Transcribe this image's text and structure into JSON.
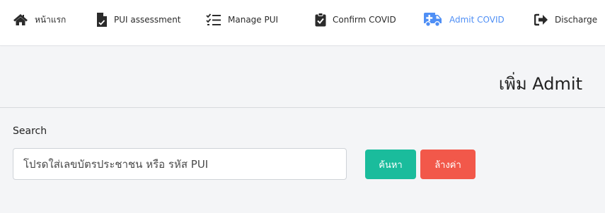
{
  "nav": {
    "items": [
      {
        "label": "หน้าแรก",
        "icon": "home-icon"
      },
      {
        "label": "PUI assessment",
        "icon": "file-medical-icon"
      },
      {
        "label": "Manage PUI",
        "icon": "task-list-icon"
      },
      {
        "label": "Confirm COVID",
        "icon": "clipboard-check-icon"
      },
      {
        "label": "Admit COVID",
        "icon": "ambulance-icon",
        "active": true
      },
      {
        "label": "Discharge",
        "icon": "sign-out-icon"
      }
    ],
    "active_color": "#4f8ff5"
  },
  "page": {
    "title": "เพิ่ม Admit"
  },
  "search": {
    "label": "Search",
    "placeholder": "โปรดใส่เลขบัตรประชาชน หรือ รหัส PUI",
    "value": "",
    "search_button": "ค้นหา",
    "clear_button": "ล้างค่า"
  },
  "colors": {
    "search_button": "#1abc9c",
    "clear_button": "#f2584a",
    "background": "#f4f5f7"
  }
}
